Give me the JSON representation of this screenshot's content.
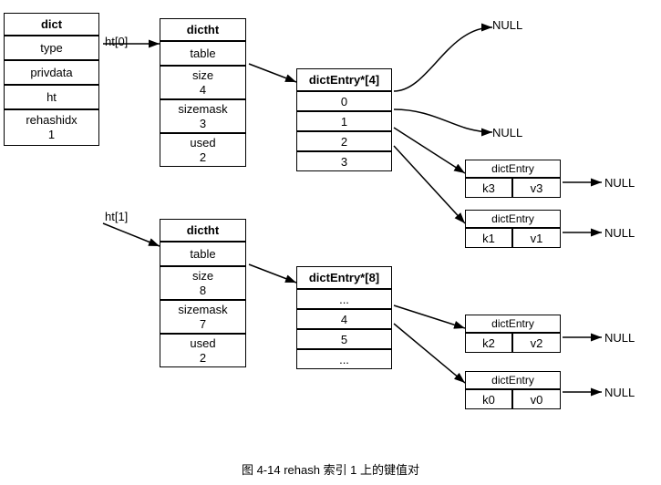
{
  "caption": "图 4-14   rehash 索引 1 上的键值对",
  "dict_box": {
    "label": "dict",
    "cells": [
      "dict",
      "type",
      "privdata",
      "ht",
      "rehashidx\n1"
    ]
  },
  "ht0_label": "ht[0]",
  "ht1_label": "ht[1]",
  "dictht0": {
    "header": "dictht",
    "cells": [
      "table",
      "size\n4",
      "sizemask\n3",
      "used\n2"
    ]
  },
  "dictht1": {
    "header": "dictht",
    "cells": [
      "table",
      "size\n8",
      "sizemask\n7",
      "used\n2"
    ]
  },
  "array0": {
    "header": "dictEntry*[4]",
    "cells": [
      "0",
      "1",
      "2",
      "3"
    ]
  },
  "array1": {
    "header": "dictEntry*[8]",
    "cells": [
      "...",
      "4",
      "5",
      "..."
    ]
  },
  "entry_k3v3": {
    "key": "k3",
    "val": "v3"
  },
  "entry_k1v1": {
    "key": "k1",
    "val": "v1"
  },
  "entry_k2v2": {
    "key": "k2",
    "val": "v2"
  },
  "entry_k0v0": {
    "key": "k0",
    "val": "v0"
  },
  "null_labels": [
    "NULL",
    "NULL",
    "NULL",
    "NULL",
    "NULL",
    "NULL"
  ],
  "dictentry_label": "dictEntry"
}
